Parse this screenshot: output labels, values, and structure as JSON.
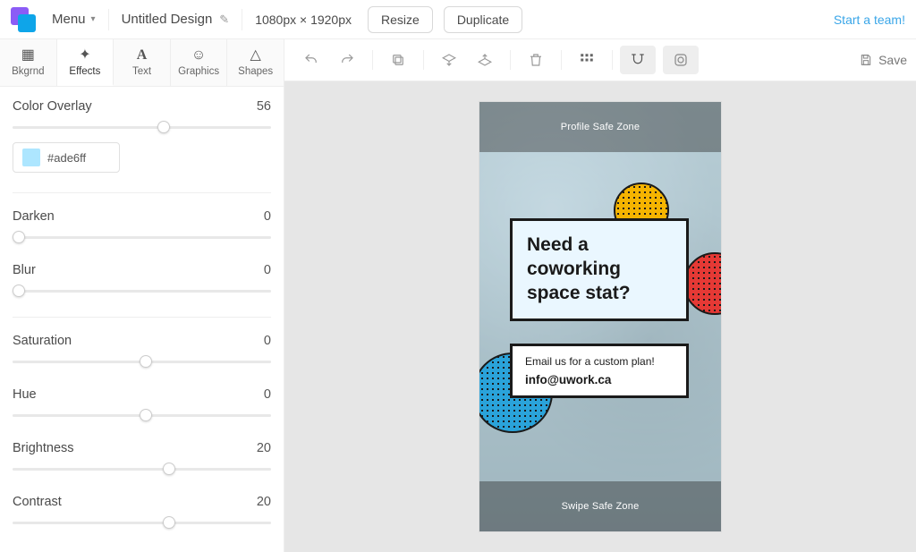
{
  "topbar": {
    "menu_label": "Menu",
    "title": "Untitled Design",
    "dimensions": "1080px × 1920px",
    "resize_label": "Resize",
    "duplicate_label": "Duplicate",
    "team_link": "Start a team!"
  },
  "sidebar": {
    "tabs": {
      "bkgrnd": "Bkgrnd",
      "effects": "Effects",
      "text": "Text",
      "graphics": "Graphics",
      "shapes": "Shapes"
    },
    "effects": {
      "color_overlay": {
        "label": "Color Overlay",
        "value": 56,
        "hex": "#ade6ff"
      },
      "darken": {
        "label": "Darken",
        "value": 0
      },
      "blur": {
        "label": "Blur",
        "value": 0
      },
      "saturation": {
        "label": "Saturation",
        "value": 0
      },
      "hue": {
        "label": "Hue",
        "value": 0
      },
      "brightness": {
        "label": "Brightness",
        "value": 20
      },
      "contrast": {
        "label": "Contrast",
        "value": 20
      }
    }
  },
  "toolbar": {
    "save_label": "Save"
  },
  "canvas": {
    "profile_safe_zone": "Profile Safe Zone",
    "swipe_safe_zone": "Swipe Safe Zone",
    "headline": "Need a coworking space stat?",
    "cta_line": "Email us for a custom plan!",
    "cta_email": "info@uwork.ca"
  }
}
